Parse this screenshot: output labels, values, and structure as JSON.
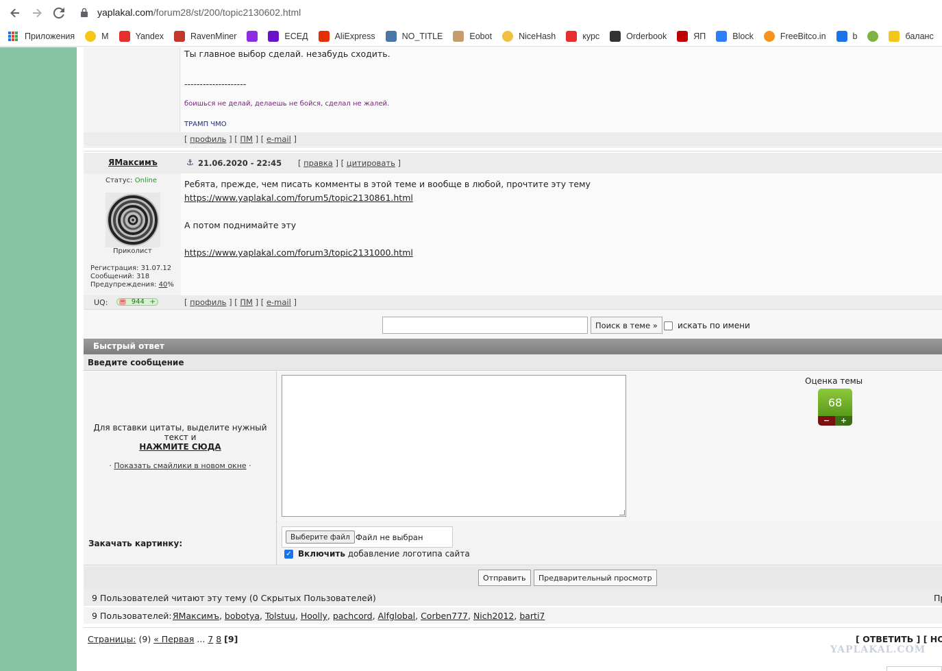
{
  "browser": {
    "url_host": "yaplakal.com",
    "url_path": "/forum28/st/200/topic2130602.html",
    "bookmarks": [
      {
        "label": "Приложения",
        "icon": "apps-grid-icon",
        "color": "#1a73e8"
      },
      {
        "label": "M",
        "icon": "smiley-icon",
        "color": "#f5c518"
      },
      {
        "label": "Yandex",
        "icon": "yandex-icon",
        "color": "#e62e2e"
      },
      {
        "label": "RavenMiner",
        "icon": "raven-icon",
        "color": "#c0392b"
      },
      {
        "label": "",
        "icon": "rocket-icon",
        "color": "#8e2de2"
      },
      {
        "label": "ЕСЕД",
        "icon": " esed-icon",
        "color": "#6a11cb"
      },
      {
        "label": "AliExpress",
        "icon": "aliexpress-icon",
        "color": "#e62e04"
      },
      {
        "label": "NO_TITLE",
        "icon": "vk-icon",
        "color": "#4a76a8"
      },
      {
        "label": "Eobot",
        "icon": "eobot-icon",
        "color": "#c69c6d"
      },
      {
        "label": "NiceHash",
        "icon": "nicehash-icon",
        "color": "#f0c040"
      },
      {
        "label": "курс",
        "icon": "yandex-icon",
        "color": "#e62e2e"
      },
      {
        "label": "Orderbook",
        "icon": "orderbook-icon",
        "color": "#333333"
      },
      {
        "label": "ЯП",
        "icon": "yap-icon",
        "color": "#c00000"
      },
      {
        "label": "Block",
        "icon": "block-icon",
        "color": "#2d7ff9"
      },
      {
        "label": "FreeBitco.in",
        "icon": "bitcoin-icon",
        "color": "#f7931a"
      },
      {
        "label": "b",
        "icon": "b-icon",
        "color": "#1a73e8"
      },
      {
        "label": "",
        "icon": "green-circle-icon",
        "color": "#7cb342"
      },
      {
        "label": "баланс",
        "icon": "folder-icon",
        "color": "#f5c518"
      },
      {
        "label": "",
        "icon": "fox-icon",
        "color": "#e65100"
      }
    ]
  },
  "prev_post": {
    "message": "Ты главное выбор сделай. незабудь сходить.",
    "divider": "--------------------",
    "sig1": "боишься не делай, делаешь не бойся, сделал не жалей.",
    "sig2": "ТРАМП ЧМО",
    "link_profile": "профиль",
    "link_pm": "ПМ",
    "link_email": "e-mail"
  },
  "post": {
    "author": "ЯМаксимъ",
    "anchor": "⚓",
    "date": "21.06.2020 - 22:45",
    "edit": "правка",
    "quote": "цитировать",
    "status_label": "Статус:",
    "status_value": "Online",
    "rank": "Приколист",
    "reg": "Регистрация: 31.07.12",
    "posts": "Сообщений: 318",
    "warn_label": "Предупреждения:",
    "warn_value": "40",
    "warn_pct": "%",
    "line1": "Ребята, прежде, чем писать комменты в этой теме и вообще в любой, прочтите эту тему",
    "link1": "https://www.yaplakal.com/forum5/topic2130861.html",
    "line2": "А потом поднимайте эту",
    "link2": "https://www.yaplakal.com/forum3/topic2131000.html",
    "uq_label": "UQ:",
    "uq_value": "944",
    "link_profile": "профиль",
    "link_pm": "ПМ",
    "link_email": "e-mail"
  },
  "search": {
    "button": "Поиск в теме »",
    "by_name": "искать по имени"
  },
  "quick_reply": {
    "title": "Быстрый ответ",
    "enter_message": "Введите сообщение",
    "quote_hint": "Для вставки цитаты, выделите нужный текст и",
    "quote_press": "НАЖМИТЕ СЮДА",
    "smiles": "Показать смайлики в новом окне",
    "rating_label": "Оценка темы",
    "rating_value": "68",
    "rating_minus": "−",
    "rating_plus": "+",
    "upload_label": "Закачать картинку:",
    "file_button": "Выберите файл",
    "file_none": "Файл не выбран",
    "logo_bold": "Включить",
    "logo_rest": " добавление логотипа сайта",
    "submit": "Отправить",
    "preview": "Предварительный просмотр"
  },
  "readers": {
    "summary": "9 Пользователей читают эту тему (0 Скрытых Пользователей)",
    "right_cut": "Пр",
    "users_label": "9 Пользователей:",
    "users": [
      "ЯМаксимъ",
      "bobotya",
      "Tolstuu",
      "Hoolly",
      "pachcord",
      "Alfglobal",
      "Corben777",
      "Nich2012",
      "barti7"
    ]
  },
  "pages": {
    "label": "Страницы:",
    "count": "(9)",
    "first": "« Первая",
    "dots": "...",
    "p7": "7",
    "p8": "8",
    "current": "[9]",
    "reply_links": "[ ОТВЕТИТЬ ] [ НО"
  },
  "watermark": "YAPLAKAL.COM"
}
